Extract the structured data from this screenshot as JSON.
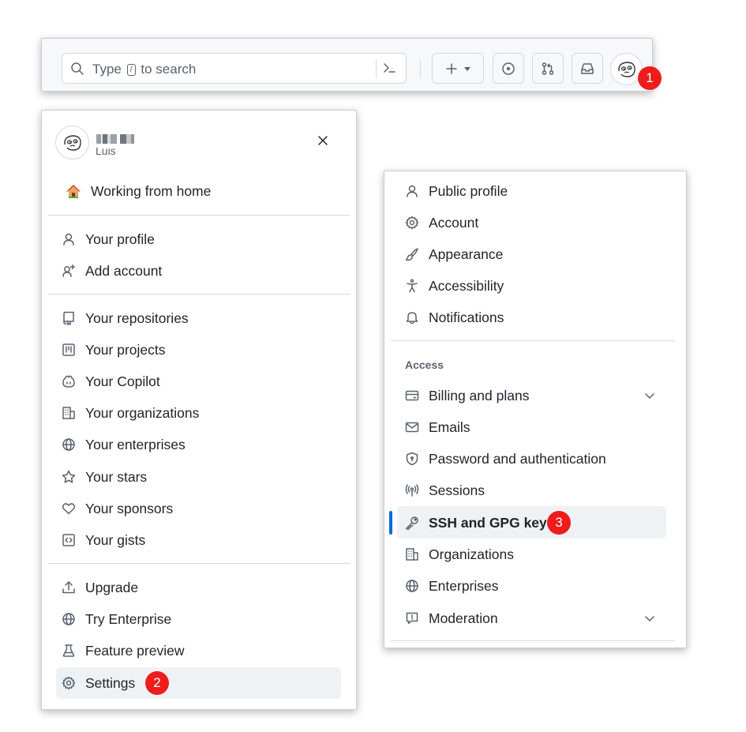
{
  "topbar": {
    "search_prefix": "Type",
    "search_key": "/",
    "search_suffix": "to search",
    "create_plus": "+"
  },
  "badges": {
    "one": "1",
    "two": "2",
    "three": "3"
  },
  "user_menu": {
    "username_sub": "Luis",
    "status": "Working from home",
    "close": "×",
    "items_a": [
      "Your profile",
      "Add account"
    ],
    "items_b": [
      "Your repositories",
      "Your projects",
      "Your Copilot",
      "Your organizations",
      "Your enterprises",
      "Your stars",
      "Your sponsors",
      "Your gists"
    ],
    "items_c": [
      "Upgrade",
      "Try Enterprise",
      "Feature preview",
      "Settings"
    ]
  },
  "settings_menu": {
    "items_a": [
      "Public profile",
      "Account",
      "Appearance",
      "Accessibility",
      "Notifications"
    ],
    "section_access": "Access",
    "items_b": [
      "Billing and plans",
      "Emails",
      "Password and authentication",
      "Sessions",
      "SSH and GPG keys",
      "Organizations",
      "Enterprises",
      "Moderation"
    ]
  },
  "colors": {
    "badge": "#ee1c1c",
    "accent": "#0969da",
    "highlight": "#eff2f5"
  }
}
